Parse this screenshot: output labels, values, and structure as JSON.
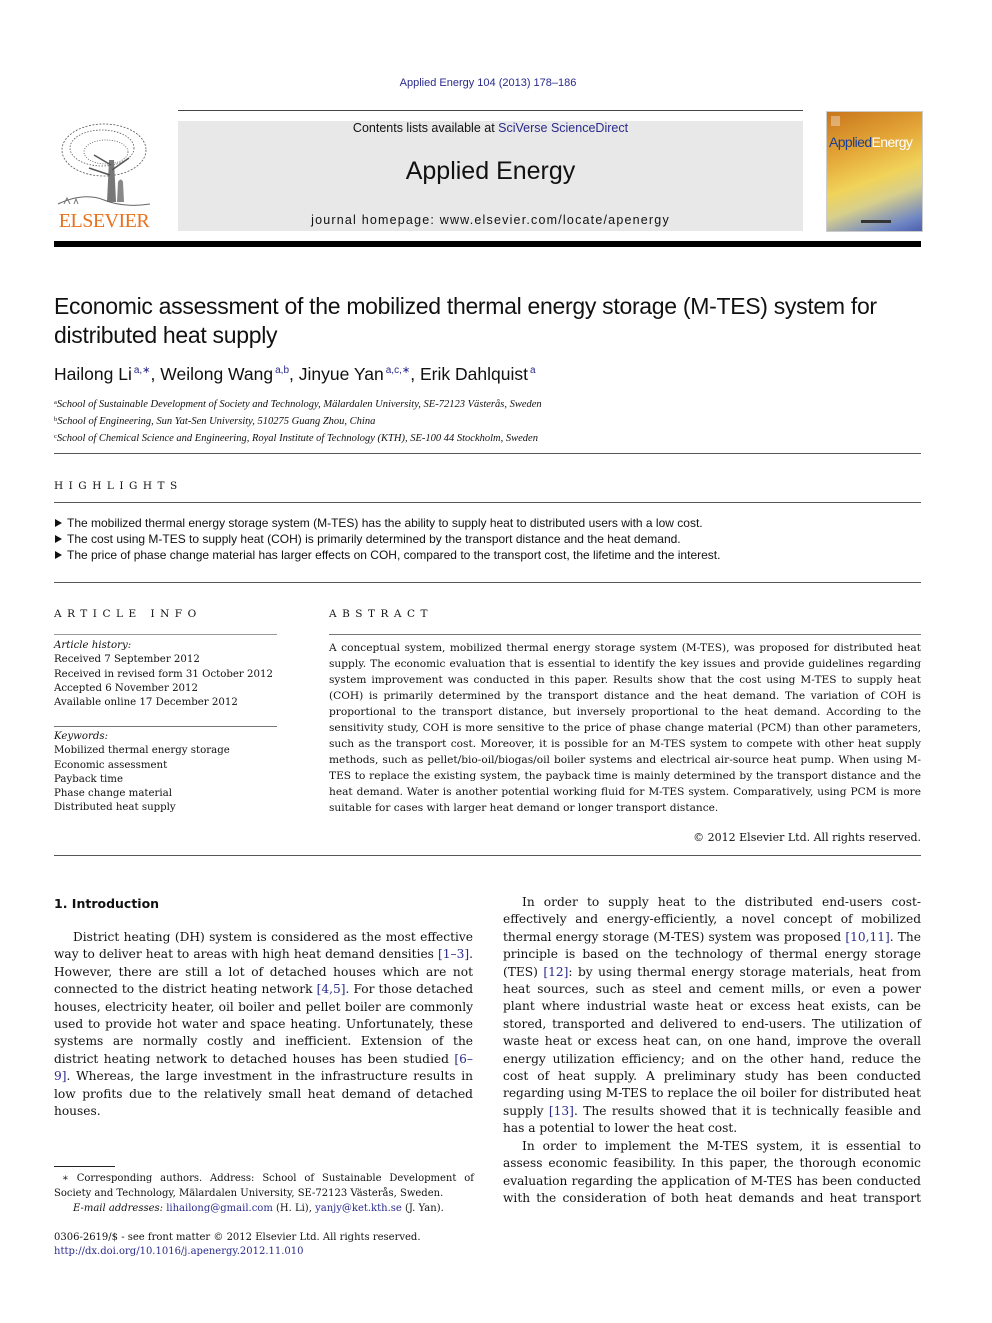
{
  "header": {
    "citation": "Applied Energy 104 (2013) 178–186",
    "contents_prefix": "Contents lists available at ",
    "contents_link": "SciVerse ScienceDirect",
    "journal_title": "Applied Energy",
    "homepage": "journal homepage: www.elsevier.com/locate/apenergy",
    "publisher_logo": "ELSEVIER",
    "cover_title_a": "Applied",
    "cover_title_b": "Energy"
  },
  "article": {
    "title": "Economic assessment of the mobilized thermal energy storage (M-TES) system for distributed heat supply",
    "authors": [
      {
        "name": "Hailong Li",
        "sup": "a,∗",
        "sep": ", "
      },
      {
        "name": "Weilong Wang",
        "sup": "a,b",
        "sep": ", "
      },
      {
        "name": "Jinyue Yan",
        "sup": "a,c,∗",
        "sep": ", "
      },
      {
        "name": "Erik Dahlquist",
        "sup": "a",
        "sep": ""
      }
    ],
    "affiliations": [
      {
        "key": "a",
        "text": "School of Sustainable Development of Society and Technology, Mälardalen University, SE-72123 Västerås, Sweden"
      },
      {
        "key": "b",
        "text": "School of Engineering, Sun Yat-Sen University, 510275 Guang Zhou, China"
      },
      {
        "key": "c",
        "text": "School of Chemical Science and Engineering, Royal Institute of Technology (KTH), SE-100 44 Stockholm, Sweden"
      }
    ]
  },
  "highlights": {
    "label": "HIGHLIGHTS",
    "items": [
      "The mobilized thermal energy storage system (M-TES) has the ability to supply heat to distributed users with a low cost.",
      "The cost using M-TES to supply heat (COH) is primarily determined by the transport distance and the heat demand.",
      "The price of phase change material has larger effects on COH, compared to the transport cost, the lifetime and the interest."
    ]
  },
  "article_info": {
    "label": "ARTICLE INFO",
    "history_label": "Article history:",
    "history": [
      "Received 7 September 2012",
      "Received in revised form 31 October 2012",
      "Accepted 6 November 2012",
      "Available online 17 December 2012"
    ],
    "keywords_label": "Keywords:",
    "keywords": [
      "Mobilized thermal energy storage",
      "Economic assessment",
      "Payback time",
      "Phase change material",
      "Distributed heat supply"
    ]
  },
  "abstract": {
    "label": "ABSTRACT",
    "text": "A conceptual system, mobilized thermal energy storage system (M-TES), was proposed for distributed heat supply. The economic evaluation that is essential to identify the key issues and provide guidelines regarding system improvement was conducted in this paper. Results show that the cost using M-TES to supply heat (COH) is primarily determined by the transport distance and the heat demand. The variation of COH is proportional to the transport distance, but inversely proportional to the heat demand. According to the sensitivity study, COH is more sensitive to the price of phase change material (PCM) than other parameters, such as the transport cost. Moreover, it is possible for an M-TES system to compete with other heat supply methods, such as pellet/bio-oil/biogas/oil boiler systems and electrical air-source heat pump. When using M-TES to replace the existing system, the payback time is mainly determined by the transport distance and the heat demand. Water is another potential working fluid for M-TES system. Comparatively, using PCM is more suitable for cases with larger heat demand or longer transport distance.",
    "copyright": "© 2012 Elsevier Ltd. All rights reserved."
  },
  "introduction": {
    "heading": "1. Introduction",
    "p1": [
      {
        "t": "District heating (DH) system is considered as the most effective way to deliver heat to areas with high heat demand densities "
      },
      {
        "ref": "[1–3]"
      },
      {
        "t": ". However, there are still a lot of detached houses which are not connected to the district heating network "
      },
      {
        "ref": "[4,5]"
      },
      {
        "t": ". For those detached houses, electricity heater, oil boiler and pellet boiler are commonly used to provide hot water and space heating. Unfortunately, these systems are normally costly and inefficient. Extension of the district heating network to detached houses has been studied "
      },
      {
        "ref": "[6–9]"
      },
      {
        "t": ". Whereas, the large investment in the infrastructure results in low profits due to the relatively small heat demand of detached houses."
      }
    ],
    "p2": [
      {
        "t": "In order to supply heat to the distributed end-users cost-effectively and energy-efficiently, a novel concept of mobilized thermal energy storage (M-TES) system was proposed "
      },
      {
        "ref": "[10,11]"
      },
      {
        "t": ". The principle is based on the technology of thermal energy storage (TES) "
      },
      {
        "ref": "[12]"
      },
      {
        "t": ": by using thermal energy storage materials, heat from heat sources, such as steel and cement mills, or even a power plant where industrial waste heat or excess heat exists, can be stored, transported and delivered to end-users. The utilization of waste heat or excess heat can, on one hand, improve the overall energy utilization efficiency; and on the other hand, reduce the cost of heat supply. A preliminary study has been conducted regarding using M-TES to replace the oil boiler for distributed heat supply "
      },
      {
        "ref": "[13]"
      },
      {
        "t": ". The results showed that it is technically feasible and has a potential to lower the heat cost."
      }
    ],
    "p3": [
      {
        "t": "In order to implement the M-TES system, it is essential to assess economic feasibility. In this paper, the thorough economic evaluation regarding the application of M-TES has been conducted with the consideration of both heat demands and heat transport"
      }
    ]
  },
  "footnote": {
    "corresponding": "∗ Corresponding authors. Address: School of Sustainable Development of Society and Technology, Mälardalen University, SE-72123 Västerås, Sweden.",
    "email_label": "E-mail addresses:",
    "email1": "lihailong@gmail.com",
    "email1_owner": " (H. Li), ",
    "email2": "yanjy@ket.kth.se",
    "email2_owner": " (J. Yan).",
    "issn": "0306-2619/$ - see front matter © 2012 Elsevier Ltd. All rights reserved.",
    "doi": "http://dx.doi.org/10.1016/j.apenergy.2012.11.010"
  }
}
